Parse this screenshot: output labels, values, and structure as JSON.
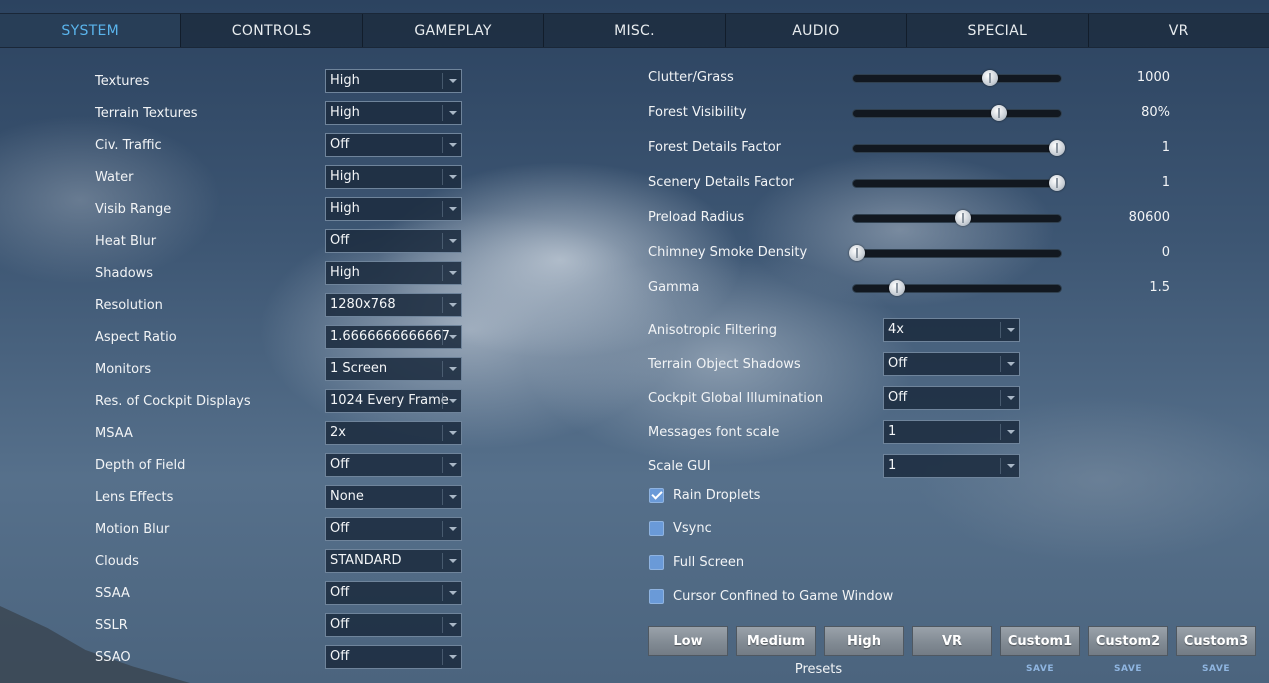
{
  "tabs": [
    {
      "label": "SYSTEM",
      "active": true
    },
    {
      "label": "CONTROLS"
    },
    {
      "label": "GAMEPLAY"
    },
    {
      "label": "MISC."
    },
    {
      "label": "AUDIO"
    },
    {
      "label": "SPECIAL"
    },
    {
      "label": "VR"
    }
  ],
  "left_settings": [
    {
      "label": "Textures",
      "value": "High"
    },
    {
      "label": "Terrain Textures",
      "value": "High"
    },
    {
      "label": "Civ. Traffic",
      "value": "Off"
    },
    {
      "label": "Water",
      "value": "High"
    },
    {
      "label": "Visib Range",
      "value": "High"
    },
    {
      "label": "Heat Blur",
      "value": "Off"
    },
    {
      "label": "Shadows",
      "value": "High"
    },
    {
      "label": "Resolution",
      "value": "1280x768"
    },
    {
      "label": "Aspect Ratio",
      "value": "1.6666666666667"
    },
    {
      "label": "Monitors",
      "value": "1 Screen"
    },
    {
      "label": "Res. of Cockpit Displays",
      "value": "1024 Every Frame"
    },
    {
      "label": "MSAA",
      "value": "2x"
    },
    {
      "label": "Depth of Field",
      "value": "Off"
    },
    {
      "label": "Lens Effects",
      "value": "None"
    },
    {
      "label": "Motion Blur",
      "value": "Off"
    },
    {
      "label": "Clouds",
      "value": "STANDARD"
    },
    {
      "label": "SSAA",
      "value": "Off"
    },
    {
      "label": "SSLR",
      "value": "Off"
    },
    {
      "label": "SSAO",
      "value": "Off"
    }
  ],
  "sliders": [
    {
      "label": "Clutter/Grass",
      "value": "1000",
      "fraction": 0.66
    },
    {
      "label": "Forest Visibility",
      "value": "80%",
      "fraction": 0.7
    },
    {
      "label": "Forest Details Factor",
      "value": "1",
      "fraction": 0.98
    },
    {
      "label": "Scenery Details Factor",
      "value": "1",
      "fraction": 0.98
    },
    {
      "label": "Preload Radius",
      "value": "80600",
      "fraction": 0.53
    },
    {
      "label": "Chimney Smoke Density",
      "value": "0",
      "fraction": 0.02
    },
    {
      "label": "Gamma",
      "value": "1.5",
      "fraction": 0.21
    }
  ],
  "right_settings": [
    {
      "label": "Anisotropic Filtering",
      "value": "4x"
    },
    {
      "label": "Terrain Object Shadows",
      "value": "Off"
    },
    {
      "label": "Cockpit Global Illumination",
      "value": "Off"
    },
    {
      "label": "Messages font scale",
      "value": "1"
    },
    {
      "label": "Scale GUI",
      "value": "1"
    }
  ],
  "checkboxes": [
    {
      "label": "Rain Droplets",
      "checked": true
    },
    {
      "label": "Vsync",
      "checked": false
    },
    {
      "label": "Full Screen",
      "checked": false
    },
    {
      "label": "Cursor Confined to Game Window",
      "checked": false
    }
  ],
  "presets": {
    "label": "Presets",
    "buttons": [
      "Low",
      "Medium",
      "High",
      "VR",
      "Custom1",
      "Custom2",
      "Custom3"
    ],
    "save_label": "SAVE"
  },
  "colors": {
    "active_tab": "#5ab4ec",
    "checkbox": "#6a9ad8",
    "save_link": "#8fb5e0"
  }
}
